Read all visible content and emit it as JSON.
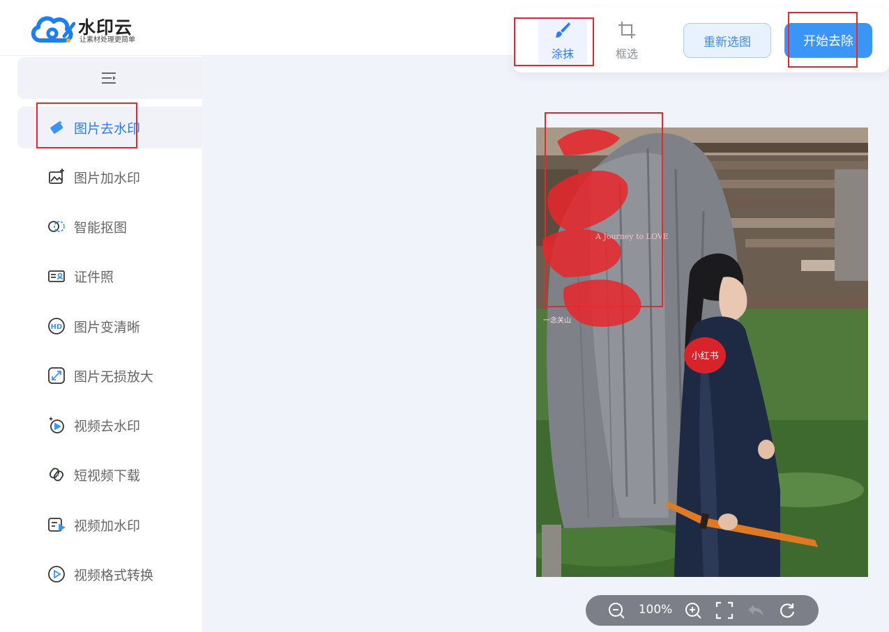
{
  "app": {
    "name": "水印云",
    "tagline": "让素材处理更简单",
    "brand_color": "#1e7ef0"
  },
  "toolbar": {
    "tools": [
      {
        "label": "涂抹",
        "icon": "brush-icon",
        "active": true
      },
      {
        "label": "框选",
        "icon": "crop-icon",
        "active": false
      }
    ],
    "reselect_label": "重新选图",
    "start_label": "开始去除"
  },
  "sidebar": {
    "collapse_icon": "menu-collapse-icon",
    "items": [
      {
        "label": "图片去水印",
        "icon": "eraser-icon",
        "active": true
      },
      {
        "label": "图片加水印",
        "icon": "image-add-icon",
        "active": false
      },
      {
        "label": "智能抠图",
        "icon": "cutout-icon",
        "active": false
      },
      {
        "label": "证件照",
        "icon": "id-card-icon",
        "active": false
      },
      {
        "label": "图片变清晰",
        "icon": "hd-icon",
        "active": false
      },
      {
        "label": "图片无损放大",
        "icon": "enlarge-icon",
        "active": false
      },
      {
        "label": "视频去水印",
        "icon": "video-remove-icon",
        "active": false
      },
      {
        "label": "短视频下载",
        "icon": "download-link-icon",
        "active": false
      },
      {
        "label": "视频加水印",
        "icon": "video-add-icon",
        "active": false
      },
      {
        "label": "视频格式转换",
        "icon": "play-circle-icon",
        "active": false
      }
    ]
  },
  "image": {
    "title_text": "一念关山",
    "subtitle_text": "A Journey to LOVE",
    "watermark_text": "小红书"
  },
  "zoom": {
    "value": "100%"
  },
  "colors": {
    "accent": "#2f7cf0",
    "start_button": "#3b95f7",
    "canvas_bg": "#f0f3fa",
    "annotation": "#e8262b"
  }
}
